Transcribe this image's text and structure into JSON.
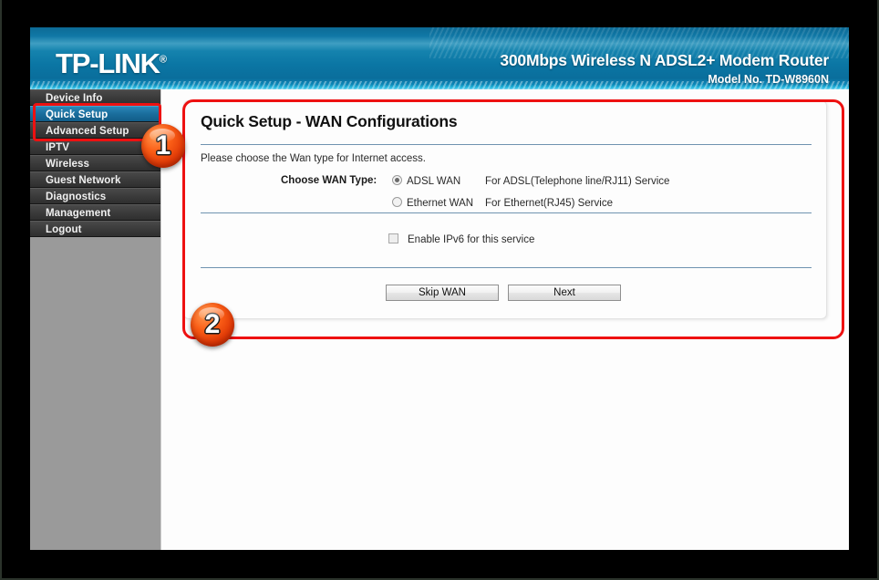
{
  "header": {
    "logo": "TP-LINK",
    "logo_mark": "®",
    "product_title": "300Mbps Wireless N ADSL2+ Modem Router",
    "model": "Model No. TD-W8960N"
  },
  "sidebar": {
    "items": [
      {
        "label": "Device Info",
        "active": false
      },
      {
        "label": "Quick Setup",
        "active": true
      },
      {
        "label": "Advanced Setup",
        "active": false
      },
      {
        "label": "IPTV",
        "active": false
      },
      {
        "label": "Wireless",
        "active": false
      },
      {
        "label": "Guest Network",
        "active": false
      },
      {
        "label": "Diagnostics",
        "active": false
      },
      {
        "label": "Management",
        "active": false
      },
      {
        "label": "Logout",
        "active": false
      }
    ]
  },
  "panel": {
    "title": "Quick Setup - WAN Configurations",
    "intro": "Please choose the Wan type for Internet access.",
    "wan_type_label": "Choose WAN Type:",
    "options": [
      {
        "name": "ADSL WAN",
        "desc": "For ADSL(Telephone line/RJ11) Service",
        "checked": true
      },
      {
        "name": "Ethernet WAN",
        "desc": "For Ethernet(RJ45) Service",
        "checked": false
      }
    ],
    "ipv6_label": "Enable IPv6 for this service",
    "ipv6_checked": false,
    "buttons": {
      "skip": "Skip WAN",
      "next": "Next"
    }
  },
  "annotations": {
    "badge_1": "1",
    "badge_2": "2",
    "accent_color": "#ee1111",
    "badge_color": "#fb5f17"
  }
}
